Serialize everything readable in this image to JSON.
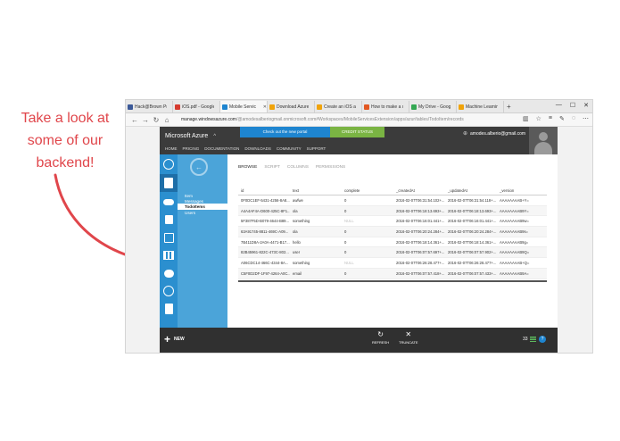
{
  "annotation": {
    "lines": [
      "Take a look at",
      "some of our",
      "backend!"
    ],
    "color": "#e0464b"
  },
  "browser": {
    "tabs": [
      {
        "label": "Hack@Brown Pre",
        "icon": "facebook-icon",
        "color": "#3b5998"
      },
      {
        "label": "iOS.pdf - Google",
        "icon": "pdf-icon",
        "color": "#d63b2f"
      },
      {
        "label": "Mobile Servic",
        "icon": "windows-icon",
        "color": "#1e85d0",
        "active": true
      },
      {
        "label": "Download Azure",
        "icon": "windows-icon",
        "color": "#f0a30a"
      },
      {
        "label": "Create an iOS app",
        "icon": "windows-icon",
        "color": "#f0a30a"
      },
      {
        "label": "How to make a ca",
        "icon": "office-icon",
        "color": "#e25822"
      },
      {
        "label": "My Drive - Googl",
        "icon": "drive-icon",
        "color": "#34a853"
      },
      {
        "label": "Machine Learning",
        "icon": "windows-icon",
        "color": "#f0a30a"
      }
    ],
    "new_tab": "+",
    "url_host": "manage.windowsazure.com",
    "url_rest": "/@amodesalberiogmail.onmicrosoft.com#Workspaces/MobileServicesExtension/apps/azur/tables/TodoItem/records"
  },
  "portal": {
    "brand": "Microsoft Azure",
    "menu": [
      "HOME",
      "PRICING",
      "DOCUMENTATION",
      "DOWNLOADS",
      "COMMUNITY",
      "SUPPORT"
    ],
    "banner_new_portal": "Check out the new portal",
    "banner_credit": "CREDIT STATUS",
    "user_email": "amodes.alberio@gmail.com",
    "sidenav": {
      "items": [
        "Item",
        "Messages",
        "TodoItems",
        "Users"
      ],
      "selected": "TodoItems"
    },
    "content_tabs": [
      "BROWSE",
      "SCRIPT",
      "COLUMNS",
      "PERMISSIONS"
    ],
    "table": {
      "headers": [
        "id",
        "text",
        "complete",
        "_createdAt",
        "_updatedAt",
        "_version"
      ],
      "rows": [
        [
          "0F0DC1EF-5431-4256-8A8...",
          "awfwe",
          "0",
          "2016-02-07T06:31:54.102+...",
          "2016-02-07T06:31:54.118+...",
          "AAAAAAAAB+Y="
        ],
        [
          "A4A4AF4A-D600-425C-8F1...",
          "ola",
          "0",
          "2016-02-07T06:18:13.693+...",
          "2016-02-07T06:18:13.693+...",
          "AAAAAAAAB9Y="
        ],
        [
          "5F387F5D-B079-4644-B89...",
          "something",
          "NULL",
          "2016-02-07T06:16:01.441+...",
          "2016-02-07T06:16:01.441+...",
          "AAAAAAAAB9w="
        ],
        [
          "63A91745-8811-469C-A09...",
          "ola",
          "0",
          "2016-02-07T06:20:24.284+...",
          "2016-02-07T06:20:24.284+...",
          "AAAAAAAAB9s="
        ],
        [
          "7B411D8A-2A0A-4471-B17...",
          "hello",
          "0",
          "2016-02-07T06:18:14.361+...",
          "2016-02-07T06:18:14.361+...",
          "AAAAAAAAB9g="
        ],
        [
          "82B45961-822C-473C-802...",
          "user",
          "0",
          "2016-02-07T06:07:57.697+...",
          "2016-02-07T06:07:57.902+...",
          "AAAAAAAAB9Q="
        ],
        [
          "A06CDC14-466C-4344-8A...",
          "something",
          "NULL",
          "2016-02-07T06:26:28.477+...",
          "2016-02-07T06:26:28.477+...",
          "AAAAAAAAB+Q="
        ],
        [
          "C5F0D2DF-1F97-4264-A0C...",
          "email",
          "0",
          "2016-02-07T06:07:57.418+...",
          "2016-02-07T06:07:57.433+...",
          "AAAAAAAAB9A="
        ]
      ]
    },
    "bottom": {
      "new_label": "NEW",
      "refresh_label": "REFRESH",
      "truncate_label": "TRUNCATE",
      "badge_count": "33"
    }
  },
  "colors": {
    "azure_blue": "#2b8fcf",
    "subnav_blue": "#4ba4d9",
    "dark_bar": "#3b3b3b",
    "green": "#7ab443"
  }
}
